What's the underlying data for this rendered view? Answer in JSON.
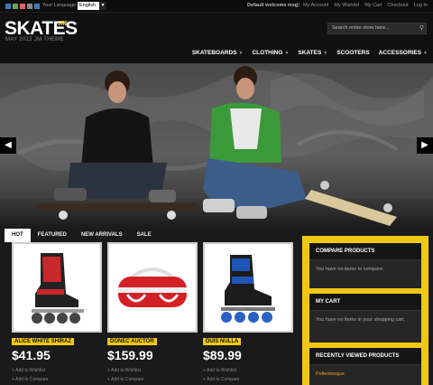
{
  "topbar": {
    "swatch_colors": [
      "#3c79b9",
      "#6aa84f",
      "#e06666",
      "#888888",
      "#3c79b9"
    ],
    "language_label": "Your Language:",
    "language_value": "English",
    "welcome": "Default welcome msg!",
    "links": [
      "My Account",
      "My Wishlist",
      "My Cart",
      "Checkout",
      "Log In"
    ]
  },
  "header": {
    "logo": "SKATES",
    "logo_badge": "JM",
    "tagline": "MAY 2012 JM THEME",
    "search_placeholder": "Search entire store here...",
    "nav": [
      {
        "label": "SKATEBOARDS",
        "has_caret": true
      },
      {
        "label": "CLOTHING",
        "has_caret": true
      },
      {
        "label": "SKATES",
        "has_caret": true
      },
      {
        "label": "SCOOTERS",
        "has_caret": false
      },
      {
        "label": "ACCESSORIES",
        "has_caret": true
      }
    ]
  },
  "tabs": [
    "HOT",
    "FEATURED",
    "NEW ARRIVALS",
    "SALE"
  ],
  "products": [
    {
      "name": "ALICE WHITE SHIRAZ",
      "price": "$41.95",
      "wishlist": "+ Add to Wishlist",
      "compare": "+ Add to Compare"
    },
    {
      "name": "DONEC AUCTOR",
      "price": "$159.99",
      "wishlist": "+ Add to Wishlist",
      "compare": "+ Add to Compare"
    },
    {
      "name": "DUIS NULLA",
      "price": "$89.99",
      "wishlist": "+ Add to Wishlist",
      "compare": "+ Add to Compare"
    }
  ],
  "sidebar": {
    "compare_title": "COMPARE PRODUCTS",
    "compare_text": "You have no items to compare.",
    "cart_title": "MY CART",
    "cart_text": "You have no items in your shopping cart.",
    "recent_title": "RECENTLY VIEWED PRODUCTS",
    "recent_item": "Pellentesque"
  }
}
